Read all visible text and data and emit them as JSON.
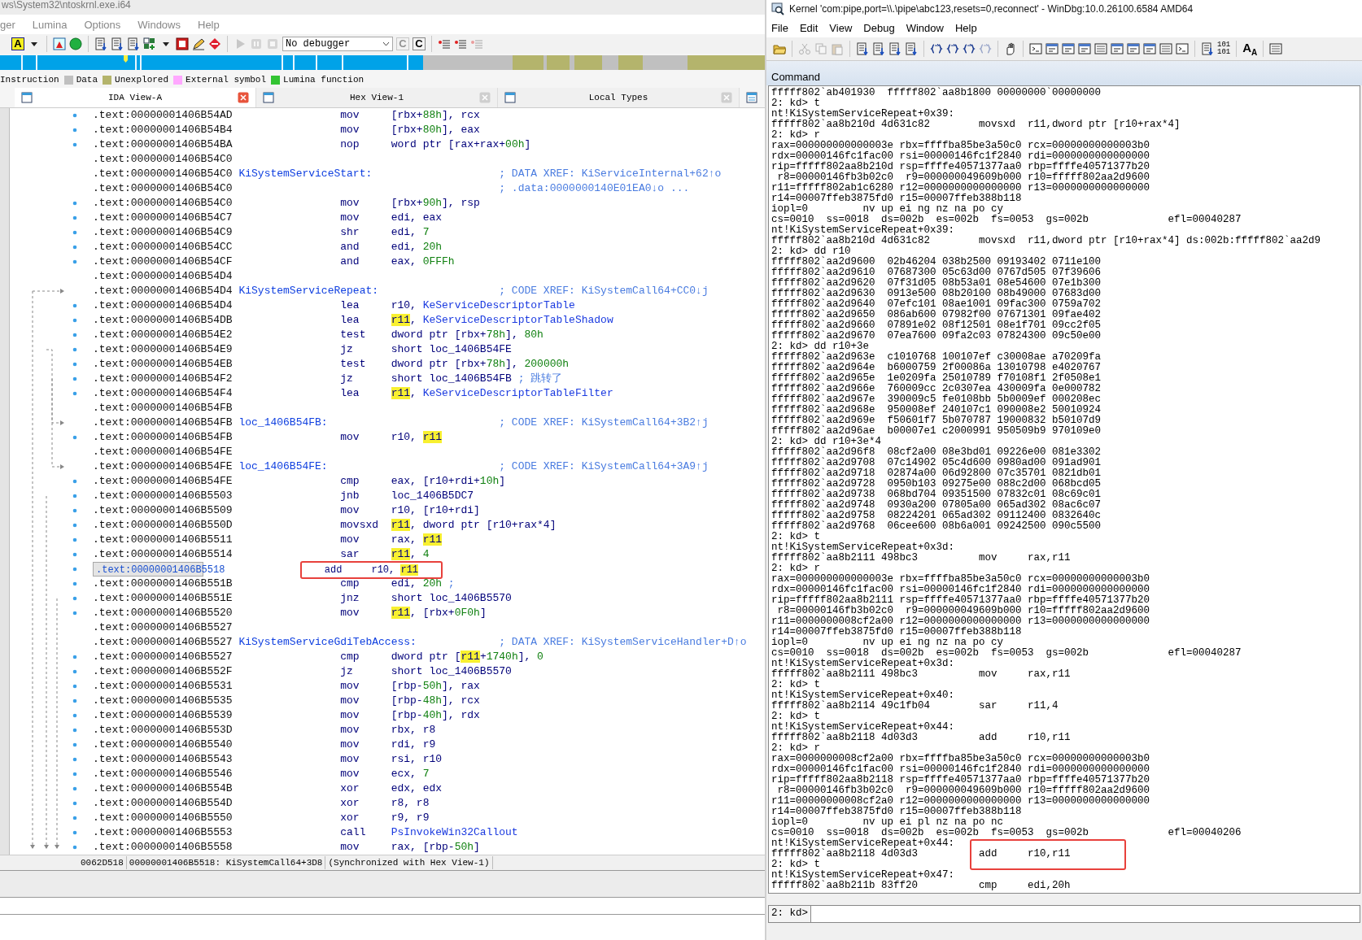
{
  "ida": {
    "title": "ws\\System32\\ntoskrnl.exe.i64",
    "menu": [
      "ger",
      "Lumina",
      "Options",
      "Windows",
      "Help"
    ],
    "toolbar": [
      {
        "kind": "letter",
        "label": "A",
        "disabled": false
      },
      {
        "kind": "caret",
        "disabled": false
      },
      {
        "kind": "separator"
      },
      {
        "kind": "warning-window",
        "disabled": false
      },
      {
        "kind": "circle",
        "disabled": false
      },
      {
        "kind": "separator"
      },
      {
        "kind": "document",
        "disabled": false
      },
      {
        "kind": "document",
        "disabled": false
      },
      {
        "kind": "document",
        "disabled": false
      },
      {
        "kind": "grid",
        "disabled": false
      },
      {
        "kind": "caret",
        "disabled": false
      },
      {
        "kind": "stop-window",
        "disabled": false
      },
      {
        "kind": "pencil",
        "disabled": false
      },
      {
        "kind": "forbidden",
        "disabled": false
      },
      {
        "kind": "separator"
      },
      {
        "kind": "play",
        "disabled": true
      },
      {
        "kind": "pause",
        "disabled": true
      },
      {
        "kind": "stop",
        "disabled": true
      },
      {
        "kind": "select",
        "value": "No debugger"
      },
      {
        "kind": "letter",
        "label": "C",
        "disabled": true
      },
      {
        "kind": "letter",
        "label": "C",
        "disabled": false
      },
      {
        "kind": "separator"
      },
      {
        "kind": "list",
        "disabled": false
      },
      {
        "kind": "list",
        "disabled": false
      },
      {
        "kind": "list",
        "disabled": true
      }
    ],
    "legend": [
      {
        "label": "Instruction"
      },
      {
        "label": "Data",
        "color": "#c0c0c0"
      },
      {
        "label": "Unexplored",
        "color": "#b4b46c"
      },
      {
        "label": "External symbol",
        "color": "#ffa8ff"
      },
      {
        "label": "Lumina function",
        "color": "#33c433"
      }
    ],
    "tabs": [
      {
        "label": "IDA View-A",
        "selected": true
      },
      {
        "label": "Hex View-1",
        "selected": false
      },
      {
        "label": "Local Types",
        "selected": false
      }
    ],
    "lines": [
      {
        "address": ".text:00000001406B54AD",
        "mnemonic": "mov",
        "operands": [
          {
            "text": "[rbx+"
          },
          {
            "text": "88h",
            "kind": "num"
          },
          {
            "text": "], rcx"
          }
        ],
        "selected": false,
        "boxed": false
      },
      {
        "address": ".text:00000001406B54B4",
        "mnemonic": "mov",
        "operands": [
          {
            "text": "[rbx+"
          },
          {
            "text": "80h",
            "kind": "num"
          },
          {
            "text": "], eax"
          }
        ],
        "selected": false,
        "boxed": false
      },
      {
        "address": ".text:00000001406B54BA",
        "mnemonic": "nop",
        "operands": [
          {
            "text": "word ptr [rax+rax+"
          },
          {
            "text": "00h",
            "kind": "num"
          },
          {
            "text": "]"
          }
        ],
        "selected": false,
        "boxed": false
      },
      {
        "address": ".text:00000001406B54C0",
        "selected": false,
        "boxed": false
      },
      {
        "address": ".text:00000001406B54C0",
        "label": "KiSystemServiceStart:",
        "comment": "; DATA XREF: KiServiceInternal+62↑o",
        "selected": false,
        "boxed": false
      },
      {
        "address": ".text:00000001406B54C0",
        "comment": "; .data:0000000140E01EA0↓o ...",
        "selected": false,
        "boxed": false
      },
      {
        "address": ".text:00000001406B54C0",
        "mnemonic": "mov",
        "operands": [
          {
            "text": "[rbx+"
          },
          {
            "text": "90h",
            "kind": "num"
          },
          {
            "text": "], rsp"
          }
        ],
        "selected": false,
        "boxed": false
      },
      {
        "address": ".text:00000001406B54C7",
        "mnemonic": "mov",
        "operands": [
          {
            "text": "edi, eax"
          }
        ],
        "selected": false,
        "boxed": false
      },
      {
        "address": ".text:00000001406B54C9",
        "mnemonic": "shr",
        "operands": [
          {
            "text": "edi, "
          },
          {
            "text": "7",
            "kind": "num"
          }
        ],
        "selected": false,
        "boxed": false
      },
      {
        "address": ".text:00000001406B54CC",
        "mnemonic": "and",
        "operands": [
          {
            "text": "edi, "
          },
          {
            "text": "20h",
            "kind": "num"
          }
        ],
        "selected": false,
        "boxed": false
      },
      {
        "address": ".text:00000001406B54CF",
        "mnemonic": "and",
        "operands": [
          {
            "text": "eax, "
          },
          {
            "text": "0FFFh",
            "kind": "num"
          }
        ],
        "selected": false,
        "boxed": false
      },
      {
        "address": ".text:00000001406B54D4",
        "selected": false,
        "boxed": false
      },
      {
        "address": ".text:00000001406B54D4",
        "label": "KiSystemServiceRepeat:",
        "comment": "; CODE XREF: KiSystemCall64+CC0↓j",
        "selected": false,
        "boxed": false
      },
      {
        "address": ".text:00000001406B54D4",
        "mnemonic": "lea",
        "operands": [
          {
            "text": "r10, "
          },
          {
            "text": "KeServiceDescriptorTable",
            "kind": "name"
          }
        ],
        "selected": false,
        "boxed": false
      },
      {
        "address": ".text:00000001406B54DB",
        "mnemonic": "lea",
        "operands": [
          {
            "text": "r11",
            "kind": "hl"
          },
          {
            "text": ", "
          },
          {
            "text": "KeServiceDescriptorTableShadow",
            "kind": "name"
          }
        ],
        "selected": false,
        "boxed": false
      },
      {
        "address": ".text:00000001406B54E2",
        "mnemonic": "test",
        "operands": [
          {
            "text": "dword ptr [rbx+"
          },
          {
            "text": "78h",
            "kind": "num"
          },
          {
            "text": "], "
          },
          {
            "text": "80h",
            "kind": "num"
          }
        ],
        "selected": false,
        "boxed": false
      },
      {
        "address": ".text:00000001406B54E9",
        "mnemonic": "jz",
        "operands": [
          {
            "text": "short loc_1406B54FE"
          }
        ],
        "selected": false,
        "boxed": false
      },
      {
        "address": ".text:00000001406B54EB",
        "mnemonic": "test",
        "operands": [
          {
            "text": "dword ptr [rbx+"
          },
          {
            "text": "78h",
            "kind": "num"
          },
          {
            "text": "], "
          },
          {
            "text": "200000h",
            "kind": "num"
          }
        ],
        "selected": false,
        "boxed": false
      },
      {
        "address": ".text:00000001406B54F2",
        "mnemonic": "jz",
        "operands": [
          {
            "text": "short loc_1406B54FB"
          }
        ],
        "comment": "; 跳转了",
        "selected": false,
        "boxed": false
      },
      {
        "address": ".text:00000001406B54F4",
        "mnemonic": "lea",
        "operands": [
          {
            "text": "r11",
            "kind": "hl"
          },
          {
            "text": ", "
          },
          {
            "text": "KeServiceDescriptorTableFilter",
            "kind": "name"
          }
        ],
        "selected": false,
        "boxed": false
      },
      {
        "address": ".text:00000001406B54FB",
        "selected": false,
        "boxed": false
      },
      {
        "address": ".text:00000001406B54FB",
        "label": "loc_1406B54FB:",
        "comment": "; CODE XREF: KiSystemCall64+3B2↑j",
        "selected": false,
        "boxed": false
      },
      {
        "address": ".text:00000001406B54FB",
        "mnemonic": "mov",
        "operands": [
          {
            "text": "r10, "
          },
          {
            "text": "r11",
            "kind": "hl"
          }
        ],
        "selected": false,
        "boxed": false
      },
      {
        "address": ".text:00000001406B54FE",
        "selected": false,
        "boxed": false
      },
      {
        "address": ".text:00000001406B54FE",
        "label": "loc_1406B54FE:",
        "comment": "; CODE XREF: KiSystemCall64+3A9↑j",
        "selected": false,
        "boxed": false
      },
      {
        "address": ".text:00000001406B54FE",
        "mnemonic": "cmp",
        "operands": [
          {
            "text": "eax, [r10+rdi+"
          },
          {
            "text": "10h",
            "kind": "num"
          },
          {
            "text": "]"
          }
        ],
        "selected": false,
        "boxed": false
      },
      {
        "address": ".text:00000001406B5503",
        "mnemonic": "jnb",
        "operands": [
          {
            "text": "loc_1406B5DC7"
          }
        ],
        "selected": false,
        "boxed": false
      },
      {
        "address": ".text:00000001406B5509",
        "mnemonic": "mov",
        "operands": [
          {
            "text": "r10, [r10+rdi]"
          }
        ],
        "selected": false,
        "boxed": false
      },
      {
        "address": ".text:00000001406B550D",
        "mnemonic": "movsxd",
        "operands": [
          {
            "text": "r11",
            "kind": "hl"
          },
          {
            "text": ", dword ptr [r10+rax*4]"
          }
        ],
        "selected": false,
        "boxed": false
      },
      {
        "address": ".text:00000001406B5511",
        "mnemonic": "mov",
        "operands": [
          {
            "text": "rax, "
          },
          {
            "text": "r11",
            "kind": "hl"
          }
        ],
        "selected": false,
        "boxed": false
      },
      {
        "address": ".text:00000001406B5514",
        "mnemonic": "sar",
        "operands": [
          {
            "text": "r11",
            "kind": "hl"
          },
          {
            "text": ", "
          },
          {
            "text": "4",
            "kind": "num"
          }
        ],
        "selected": false,
        "boxed": false
      },
      {
        "address": ".text:00000001406B5518",
        "mnemonic": "add",
        "operands": [
          {
            "text": "r10, "
          },
          {
            "text": "r11",
            "kind": "hl"
          }
        ],
        "selected": true,
        "boxed": true
      },
      {
        "address": ".text:00000001406B551B",
        "mnemonic": "cmp",
        "operands": [
          {
            "text": "edi, "
          },
          {
            "text": "20h",
            "kind": "num"
          }
        ],
        "comment": ";",
        "selected": false,
        "boxed": false
      },
      {
        "address": ".text:00000001406B551E",
        "mnemonic": "jnz",
        "operands": [
          {
            "text": "short loc_1406B5570"
          }
        ],
        "selected": false,
        "boxed": false
      },
      {
        "address": ".text:00000001406B5520",
        "mnemonic": "mov",
        "operands": [
          {
            "text": "r11",
            "kind": "hl"
          },
          {
            "text": ", [rbx+"
          },
          {
            "text": "0F0h",
            "kind": "num"
          },
          {
            "text": "]"
          }
        ],
        "selected": false,
        "boxed": false
      },
      {
        "address": ".text:00000001406B5527",
        "selected": false,
        "boxed": false
      },
      {
        "address": ".text:00000001406B5527",
        "label": "KiSystemServiceGdiTebAccess:",
        "comment": "; DATA XREF: KiSystemServiceHandler+D↑o",
        "selected": false,
        "boxed": false
      },
      {
        "address": ".text:00000001406B5527",
        "mnemonic": "cmp",
        "operands": [
          {
            "text": "dword ptr ["
          },
          {
            "text": "r11",
            "kind": "hl"
          },
          {
            "text": "+"
          },
          {
            "text": "1740h",
            "kind": "num"
          },
          {
            "text": "], "
          },
          {
            "text": "0",
            "kind": "num"
          }
        ],
        "selected": false,
        "boxed": false
      },
      {
        "address": ".text:00000001406B552F",
        "mnemonic": "jz",
        "operands": [
          {
            "text": "short loc_1406B5570"
          }
        ],
        "selected": false,
        "boxed": false
      },
      {
        "address": ".text:00000001406B5531",
        "mnemonic": "mov",
        "operands": [
          {
            "text": "[rbp-"
          },
          {
            "text": "50h",
            "kind": "num"
          },
          {
            "text": "], rax"
          }
        ],
        "selected": false,
        "boxed": false
      },
      {
        "address": ".text:00000001406B5535",
        "mnemonic": "mov",
        "operands": [
          {
            "text": "[rbp-"
          },
          {
            "text": "48h",
            "kind": "num"
          },
          {
            "text": "], rcx"
          }
        ],
        "selected": false,
        "boxed": false
      },
      {
        "address": ".text:00000001406B5539",
        "mnemonic": "mov",
        "operands": [
          {
            "text": "[rbp-"
          },
          {
            "text": "40h",
            "kind": "num"
          },
          {
            "text": "], rdx"
          }
        ],
        "selected": false,
        "boxed": false
      },
      {
        "address": ".text:00000001406B553D",
        "mnemonic": "mov",
        "operands": [
          {
            "text": "rbx, r8"
          }
        ],
        "selected": false,
        "boxed": false
      },
      {
        "address": ".text:00000001406B5540",
        "mnemonic": "mov",
        "operands": [
          {
            "text": "rdi, r9"
          }
        ],
        "selected": false,
        "boxed": false
      },
      {
        "address": ".text:00000001406B5543",
        "mnemonic": "mov",
        "operands": [
          {
            "text": "rsi, r10"
          }
        ],
        "selected": false,
        "boxed": false
      },
      {
        "address": ".text:00000001406B5546",
        "mnemonic": "mov",
        "operands": [
          {
            "text": "ecx, "
          },
          {
            "text": "7",
            "kind": "num"
          }
        ],
        "selected": false,
        "boxed": false
      },
      {
        "address": ".text:00000001406B554B",
        "mnemonic": "xor",
        "operands": [
          {
            "text": "edx, edx"
          }
        ],
        "selected": false,
        "boxed": false
      },
      {
        "address": ".text:00000001406B554D",
        "mnemonic": "xor",
        "operands": [
          {
            "text": "r8, r8"
          }
        ],
        "selected": false,
        "boxed": false
      },
      {
        "address": ".text:00000001406B5550",
        "mnemonic": "xor",
        "operands": [
          {
            "text": "r9, r9"
          }
        ],
        "selected": false,
        "boxed": false
      },
      {
        "address": ".text:00000001406B5553",
        "mnemonic": "call",
        "operands": [
          {
            "text": "PsInvokeWin32Callout",
            "kind": "name"
          }
        ],
        "selected": false,
        "boxed": false
      },
      {
        "address": ".text:00000001406B5558",
        "mnemonic": "mov",
        "operands": [
          {
            "text": "rax, [rbp-"
          },
          {
            "text": "50h",
            "kind": "num"
          },
          {
            "text": "]"
          }
        ],
        "selected": false,
        "boxed": false
      }
    ],
    "status": [
      "0062D518",
      "00000001406B5518: KiSystemCall64+3D8",
      "(Synchronized with Hex View-1)"
    ]
  },
  "windbg": {
    "title": "Kernel 'com:pipe,port=\\\\.\\pipe\\abc123,resets=0,reconnect' - WinDbg:10.0.26100.6584 AMD64",
    "menu": [
      "File",
      "Edit",
      "View",
      "Debug",
      "Window",
      "Help"
    ],
    "toolbar": [
      {
        "kind": "folder",
        "disabled": false
      },
      {
        "kind": "separator"
      },
      {
        "kind": "scissors",
        "disabled": true
      },
      {
        "kind": "copy",
        "disabled": true
      },
      {
        "kind": "paste",
        "disabled": true
      },
      {
        "kind": "separator"
      },
      {
        "kind": "document",
        "disabled": false
      },
      {
        "kind": "document",
        "disabled": false
      },
      {
        "kind": "document",
        "disabled": false
      },
      {
        "kind": "document",
        "disabled": false
      },
      {
        "kind": "separator"
      },
      {
        "kind": "braces",
        "disabled": false
      },
      {
        "kind": "braces",
        "disabled": false
      },
      {
        "kind": "braces",
        "disabled": false
      },
      {
        "kind": "braces",
        "disabled": true
      },
      {
        "kind": "separator"
      },
      {
        "kind": "hand",
        "disabled": false
      },
      {
        "kind": "separator"
      },
      {
        "kind": "terminal",
        "disabled": false
      },
      {
        "kind": "window",
        "disabled": false
      },
      {
        "kind": "window",
        "disabled": false
      },
      {
        "kind": "window",
        "disabled": false
      },
      {
        "kind": "list-window",
        "disabled": false
      },
      {
        "kind": "window",
        "disabled": false
      },
      {
        "kind": "window",
        "disabled": false
      },
      {
        "kind": "window",
        "disabled": false
      },
      {
        "kind": "list-window",
        "disabled": false
      },
      {
        "kind": "terminal",
        "disabled": false
      },
      {
        "kind": "separator"
      },
      {
        "kind": "document",
        "disabled": false
      },
      {
        "kind": "text",
        "label": "101\n101",
        "disabled": false
      },
      {
        "kind": "separator"
      },
      {
        "kind": "text",
        "label": "A$_{A}$",
        "disabled": false
      },
      {
        "kind": "separator"
      },
      {
        "kind": "list-window",
        "disabled": false
      }
    ],
    "panel_title": "Command",
    "output": [
      "fffff802`ab401930  fffff802`aa8b1800 00000000`00000000",
      "2: kd> t",
      "nt!KiSystemServiceRepeat+0x39:",
      "fffff802`aa8b210d 4d631c82        movsxd  r11,dword ptr [r10+rax*4]",
      "2: kd> r",
      "rax=000000000000003e rbx=ffffba85be3a50c0 rcx=00000000000003b0",
      "rdx=00000146fc1fac00 rsi=00000146fc1f2840 rdi=0000000000000000",
      "rip=fffff802aa8b210d rsp=ffffe40571377aa0 rbp=ffffe40571377b20",
      " r8=00000146fb3b02c0  r9=000000049609b000 r10=fffff802aa2d9600",
      "r11=fffff802ab1c6280 r12=0000000000000000 r13=0000000000000000",
      "r14=00007ffeb3875fd0 r15=00007ffeb388b118",
      "iopl=0         nv up ei ng nz na po cy",
      "cs=0010  ss=0018  ds=002b  es=002b  fs=0053  gs=002b             efl=00040287",
      "nt!KiSystemServiceRepeat+0x39:",
      "fffff802`aa8b210d 4d631c82        movsxd  r11,dword ptr [r10+rax*4] ds:002b:fffff802`aa2d9",
      "2: kd> dd r10",
      "fffff802`aa2d9600  02b46204 038b2500 09193402 0711e100",
      "fffff802`aa2d9610  07687300 05c63d00 0767d505 07f39606",
      "fffff802`aa2d9620  07f31d05 08b53a01 08e54600 07e1b300",
      "fffff802`aa2d9630  0913e500 08b20100 08b49000 07683d00",
      "fffff802`aa2d9640  07efc101 08ae1001 09fac300 0759a702",
      "fffff802`aa2d9650  086ab600 07982f00 07671301 09fae402",
      "fffff802`aa2d9660  07891e02 08f12501 08e1f701 09cc2f05",
      "fffff802`aa2d9670  07ea7600 09fa2c03 07824300 09c50e00",
      "2: kd> dd r10+3e",
      "fffff802`aa2d963e  c1010768 100107ef c30008ae a70209fa",
      "fffff802`aa2d964e  b6000759 2f00086a 13010798 e4020767",
      "fffff802`aa2d965e  1e0209fa 25010789 f70108f1 2f0508e1",
      "fffff802`aa2d966e  760009cc 2c0307ea 430009fa 0e000782",
      "fffff802`aa2d967e  390009c5 fe0108bb 5b0009ef 000208ec",
      "fffff802`aa2d968e  950008ef 240107c1 090008e2 50010924",
      "fffff802`aa2d969e  f50601f7 5b070787 19000832 b50107d9",
      "fffff802`aa2d96ae  b00007e1 c2000991 950509b9 970109e0",
      "2: kd> dd r10+3e*4",
      "fffff802`aa2d96f8  08cf2a00 08e3bd01 09226e00 081e3302",
      "fffff802`aa2d9708  07c14902 05c4d600 0980ad00 091ad901",
      "fffff802`aa2d9718  02874a00 06d92800 07c35701 0821db01",
      "fffff802`aa2d9728  0950b103 09275e00 088c2d00 068bcd05",
      "fffff802`aa2d9738  068bd704 09351500 07832c01 08c69c01",
      "fffff802`aa2d9748  0930a200 07805a00 065ad302 08ac6c07",
      "fffff802`aa2d9758  08224201 065ad302 09112400 0832640c",
      "fffff802`aa2d9768  06cee600 08b6a001 09242500 090c5500",
      "2: kd> t",
      "nt!KiSystemServiceRepeat+0x3d:",
      "fffff802`aa8b2111 498bc3          mov     rax,r11",
      "2: kd> r",
      "rax=000000000000003e rbx=ffffba85be3a50c0 rcx=00000000000003b0",
      "rdx=00000146fc1fac00 rsi=00000146fc1f2840 rdi=0000000000000000",
      "rip=fffff802aa8b2111 rsp=ffffe40571377aa0 rbp=ffffe40571377b20",
      " r8=00000146fb3b02c0  r9=000000049609b000 r10=fffff802aa2d9600",
      "r11=0000000008cf2a00 r12=0000000000000000 r13=0000000000000000",
      "r14=00007ffeb3875fd0 r15=00007ffeb388b118",
      "iopl=0         nv up ei ng nz na po cy",
      "cs=0010  ss=0018  ds=002b  es=002b  fs=0053  gs=002b             efl=00040287",
      "nt!KiSystemServiceRepeat+0x3d:",
      "fffff802`aa8b2111 498bc3          mov     rax,r11",
      "2: kd> t",
      "nt!KiSystemServiceRepeat+0x40:",
      "fffff802`aa8b2114 49c1fb04        sar     r11,4",
      "2: kd> t",
      "nt!KiSystemServiceRepeat+0x44:",
      "fffff802`aa8b2118 4d03d3          add     r10,r11",
      "2: kd> r",
      "rax=0000000008cf2a00 rbx=ffffba85be3a50c0 rcx=00000000000003b0",
      "rdx=00000146fc1fac00 rsi=00000146fc1f2840 rdi=0000000000000000",
      "rip=fffff802aa8b2118 rsp=ffffe40571377aa0 rbp=ffffe40571377b20",
      " r8=00000146fb3b02c0  r9=000000049609b000 r10=fffff802aa2d9600",
      "r11=00000000008cf2a0 r12=0000000000000000 r13=0000000000000000",
      "r14=00007ffeb3875fd0 r15=00007ffeb388b118",
      "iopl=0         nv up ei pl nz na po nc",
      "cs=0010  ss=0018  ds=002b  es=002b  fs=0053  gs=002b             efl=00040206",
      "nt!KiSystemServiceRepeat+0x44:",
      {
        "text": "fffff802`aa8b2118 4d03d3          ",
        "boxed": "add     r10,r11"
      },
      "2: kd> t",
      "nt!KiSystemServiceRepeat+0x47:",
      "fffff802`aa8b211b 83ff20          cmp     edi,20h"
    ],
    "prompt": "2: kd>"
  }
}
